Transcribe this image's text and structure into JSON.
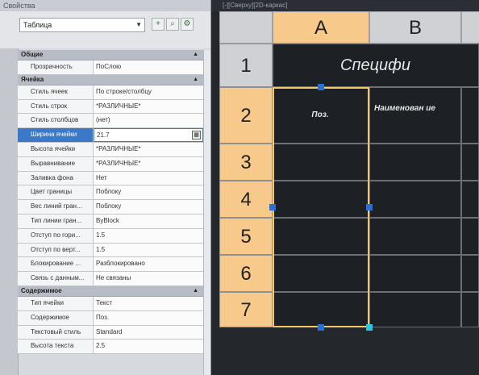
{
  "palette": {
    "title": "Свойства",
    "object_type": "Таблица",
    "sections": [
      {
        "name": "Общие",
        "rows": [
          {
            "key": "Прозрачность",
            "value": "ПоСлою"
          }
        ]
      },
      {
        "name": "Ячейка",
        "rows": [
          {
            "key": "Стиль ячеек",
            "value": "По строке/столбцу"
          },
          {
            "key": "Стиль строк",
            "value": "*РАЗЛИЧНЫЕ*"
          },
          {
            "key": "Стиль столбцов",
            "value": "(нет)"
          },
          {
            "key": "Ширина ячейки",
            "value": "21.7"
          },
          {
            "key": "Высота ячейки",
            "value": "*РАЗЛИЧНЫЕ*"
          },
          {
            "key": "Выравнивание",
            "value": "*РАЗЛИЧНЫЕ*"
          },
          {
            "key": "Заливка фона",
            "value": "Нет"
          },
          {
            "key": "Цвет границы",
            "value": "Поблоку"
          },
          {
            "key": "Вес линий гран...",
            "value": "Поблоку"
          },
          {
            "key": "Тип линии гран...",
            "value": "ByBlock"
          },
          {
            "key": "Отступ по гори...",
            "value": "1.5"
          },
          {
            "key": "Отступ по верт...",
            "value": "1.5"
          },
          {
            "key": "Блокирование ...",
            "value": "Разблокировано"
          },
          {
            "key": "Связь с данным...",
            "value": "Не связаны"
          }
        ]
      },
      {
        "name": "Содержимое",
        "rows": [
          {
            "key": "Тип ячейки",
            "value": "Текст"
          },
          {
            "key": "Содержимое",
            "value": "Поз."
          },
          {
            "key": "Текстовый стиль",
            "value": "Standard"
          },
          {
            "key": "Высота текста",
            "value": "2.5"
          }
        ]
      }
    ]
  },
  "drawing": {
    "caption": "[-][Сверху][2D-каркас]",
    "columns": [
      "A",
      "B"
    ],
    "rows": [
      "1",
      "2",
      "3",
      "4",
      "5",
      "6",
      "7"
    ],
    "title_text": "Специфи",
    "header_cells": [
      "Поз.",
      "Наименован ие"
    ]
  },
  "colors": {
    "selection": "#f4c56a",
    "header_highlight": "#f7c98a",
    "grip": "#2a6fd6",
    "row_selected": "#3b78c7"
  }
}
